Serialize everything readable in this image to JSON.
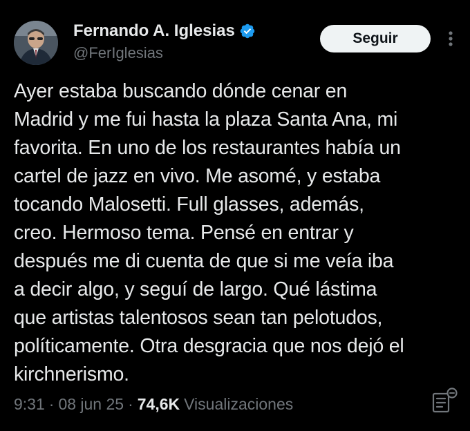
{
  "author": {
    "display_name": "Fernando A. Iglesias",
    "handle": "@FerIglesias",
    "verified_badge_icon": "verified-badge-icon",
    "verified_color": "#1d9bf0"
  },
  "follow_button": {
    "label": "Seguir"
  },
  "more_menu_icon": "more-vertical-icon",
  "tweet": {
    "lines": [
      "Ayer estaba buscando dónde cenar en",
      "Madrid y me fui hasta la plaza Santa Ana, mi",
      "favorita. En uno de los restaurantes había un",
      "cartel de jazz en vivo. Me asomé, y estaba",
      "tocando Malosetti. Full glasses, además,",
      "creo. Hermoso tema. Pensé en entrar y",
      "después me di cuenta de que si me veía iba",
      "a decir algo, y seguí de largo. Qué lástima",
      "que artistas talentosos sean tan pelotudos,",
      "políticamente. Otra desgracia que nos dejó el",
      "kirchnerismo."
    ]
  },
  "meta": {
    "time": "9:31",
    "separator": "·",
    "date": "08 jun 25",
    "views_count": "74,6K",
    "views_label": "Visualizaciones"
  },
  "analytics_icon": "post-analytics-icon",
  "colors": {
    "background": "#000000",
    "text": "#e7e9ea",
    "secondary_text": "#71767b",
    "button_bg": "#eff3f4"
  }
}
